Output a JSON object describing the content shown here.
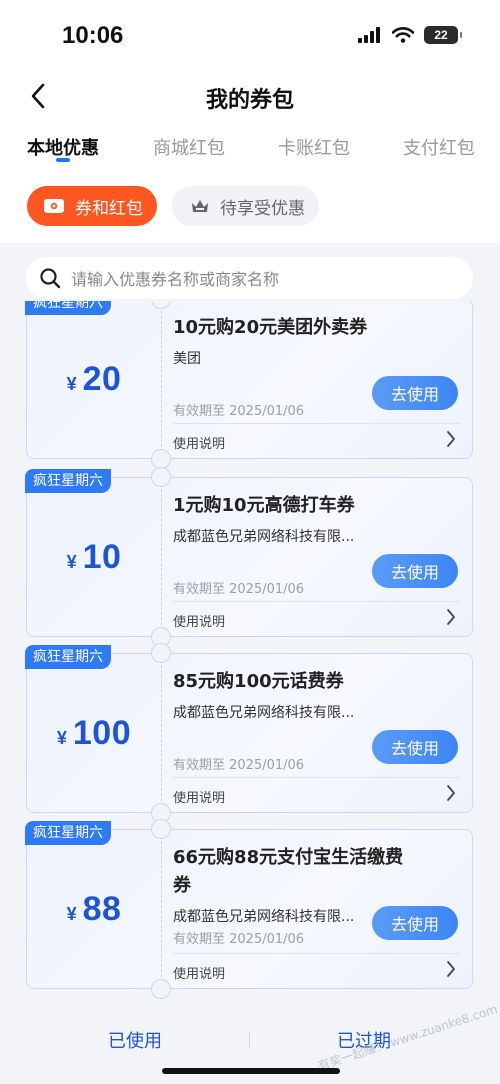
{
  "status_bar": {
    "time": "10:06",
    "battery": "22"
  },
  "nav": {
    "title": "我的券包"
  },
  "tabs": [
    {
      "label": "本地优惠",
      "active": true
    },
    {
      "label": "商城红包",
      "active": false
    },
    {
      "label": "卡账红包",
      "active": false
    },
    {
      "label": "支付红包",
      "active": false
    }
  ],
  "filters": [
    {
      "label": "券和红包",
      "active": true,
      "icon": "ticket-icon"
    },
    {
      "label": "待享受优惠",
      "active": false,
      "icon": "crown-icon"
    }
  ],
  "search": {
    "placeholder": "请输入优惠券名称或商家名称"
  },
  "coupons": [
    {
      "badge": "疯狂星期六",
      "yen": "¥",
      "amount": "20",
      "title": "10元购20元美团外卖券",
      "merchant": "美团",
      "expiry": "有效期至 2025/01/06",
      "use_label": "去使用",
      "instructions": "使用说明"
    },
    {
      "badge": "疯狂星期六",
      "yen": "¥",
      "amount": "10",
      "title": "1元购10元高德打车券",
      "merchant": "成都蓝色兄弟网络科技有限...",
      "expiry": "有效期至 2025/01/06",
      "use_label": "去使用",
      "instructions": "使用说明"
    },
    {
      "badge": "疯狂星期六",
      "yen": "¥",
      "amount": "100",
      "title": "85元购100元话费券",
      "merchant": "成都蓝色兄弟网络科技有限...",
      "expiry": "有效期至 2025/01/06",
      "use_label": "去使用",
      "instructions": "使用说明"
    },
    {
      "badge": "疯狂星期六",
      "yen": "¥",
      "amount": "88",
      "title": "66元购88元支付宝生活缴费券",
      "merchant": "成都蓝色兄弟网络科技有限...",
      "expiry": "有效期至 2025/01/06",
      "use_label": "去使用",
      "instructions": "使用说明"
    }
  ],
  "bottom": {
    "used_label": "已使用",
    "expired_label": "已过期"
  },
  "watermark": "...有奖一起赚！ www.zuanke8.com",
  "colors": {
    "accent": "#1677ff",
    "chip_active": "#ff5722",
    "badge": "#2f7bf5",
    "amount": "#1d55d6"
  }
}
